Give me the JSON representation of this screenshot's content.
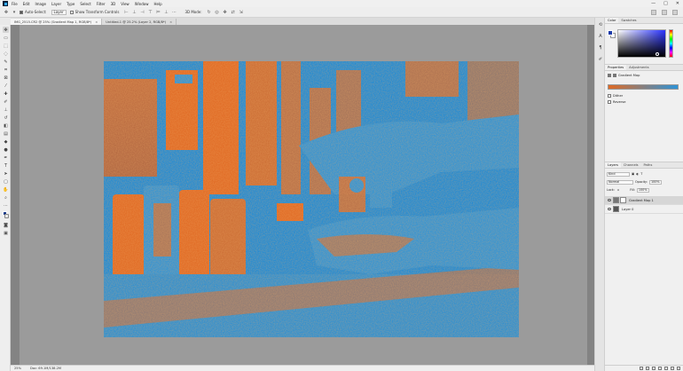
{
  "menu": {
    "items": [
      "File",
      "Edit",
      "Image",
      "Layer",
      "Type",
      "Select",
      "Filter",
      "3D",
      "View",
      "Window",
      "Help"
    ],
    "window_controls": [
      "—",
      "□",
      "✕"
    ]
  },
  "options": {
    "auto_select_label": "Auto-Select:",
    "auto_select_target": "Layer",
    "show_transform_label": "Show Transform Controls",
    "mode_3d_label": "3D Mode:"
  },
  "tabs": [
    {
      "label": "IMG_2515.CR2 @ 25% (Gradient Map 1, RGB/8*)",
      "close": "×"
    },
    {
      "label": "Untitled-1 @ 25.2% (Layer 2, RGB/8*)",
      "close": "×"
    }
  ],
  "status": {
    "zoom": "25%",
    "doc_info": "Doc: 69.1M/138.2M"
  },
  "panels": {
    "color_tabs": [
      "Color",
      "Swatches"
    ],
    "properties_tabs": [
      "Properties",
      "Adjustments"
    ],
    "properties_title": "Gradient Map",
    "dither_label": "Dither",
    "reverse_label": "Reverse",
    "layers_tabs": [
      "Layers",
      "Channels",
      "Paths"
    ],
    "kind_label": "Kind",
    "blend_mode": "Normal",
    "opacity_label": "Opacity:",
    "opacity_value": "100%",
    "lock_label": "Lock:",
    "fill_label": "Fill:",
    "fill_value": "100%",
    "layers": [
      {
        "name": "Gradient Map 1",
        "selected": true
      },
      {
        "name": "Layer 0",
        "selected": false
      }
    ]
  },
  "colors": {
    "gradient_start": "#e06a24",
    "gradient_end": "#2d93d8",
    "foreground": "#1d3ba8",
    "background": "#ffffff"
  }
}
